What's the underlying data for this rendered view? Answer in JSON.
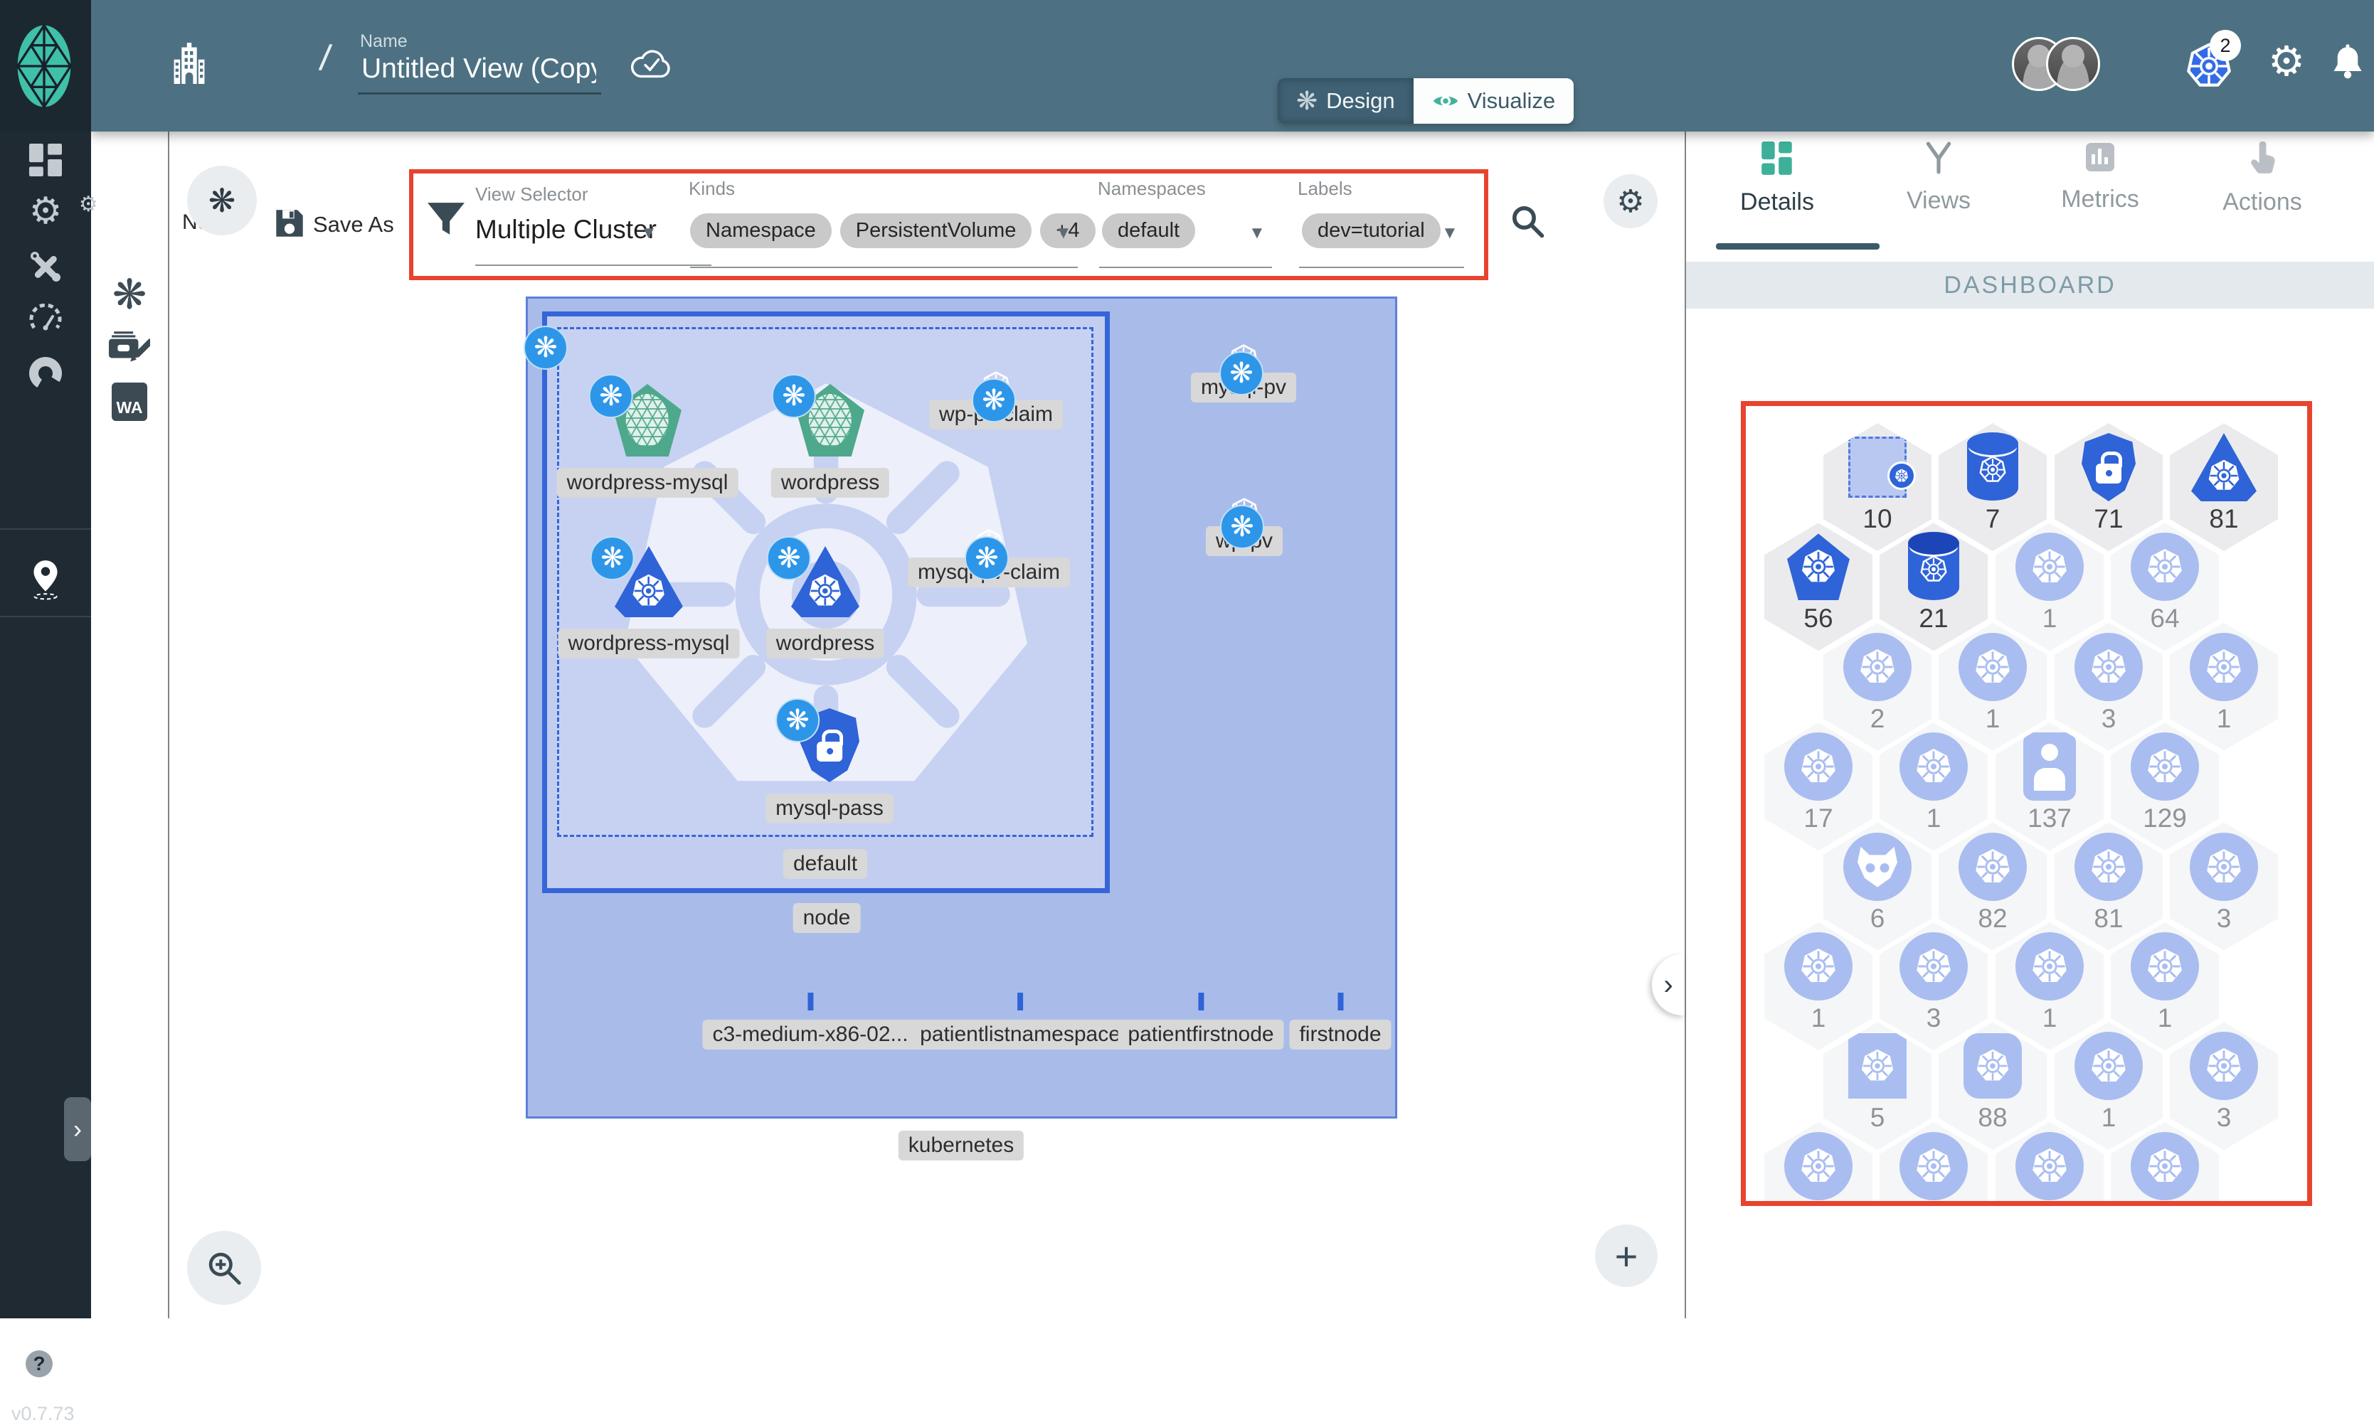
{
  "app": {
    "version": "v0.7.73",
    "help_label": "?"
  },
  "header": {
    "name_label": "Name",
    "name_value": "Untitled View (Copy)",
    "breadcrumb_separator": "/",
    "mode_design": "Design",
    "mode_visualize": "Visualize",
    "k8s_context_count": "2"
  },
  "toolbar": {
    "new_label": "New",
    "save_as_label": "Save As",
    "view_selector_label": "View Selector",
    "view_selector_value": "Multiple Cluster",
    "kinds_label": "Kinds",
    "kinds_chips": [
      "Namespace",
      "PersistentVolume",
      "+4"
    ],
    "namespaces_label": "Namespaces",
    "namespaces_chips": [
      "default"
    ],
    "labels_label": "Labels",
    "labels_chips": [
      "dev=tutorial"
    ]
  },
  "rail": {
    "wasm_label": "WA"
  },
  "panel": {
    "tabs": [
      {
        "label": "Details",
        "active": true
      },
      {
        "label": "Views",
        "active": false
      },
      {
        "label": "Metrics",
        "active": false
      },
      {
        "label": "Actions",
        "active": false
      }
    ],
    "section_title": "DASHBOARD",
    "hex_rows": [
      [
        {
          "icon": "namespace",
          "count": "10",
          "tone": "dark"
        },
        {
          "icon": "pv",
          "count": "7",
          "tone": "dark"
        },
        {
          "icon": "secret",
          "count": "71",
          "tone": "dark"
        },
        {
          "icon": "deployment",
          "count": "81",
          "tone": "dark"
        }
      ],
      [
        {
          "icon": "node",
          "count": "56",
          "tone": "dark"
        },
        {
          "icon": "pvc",
          "count": "21",
          "tone": "dark"
        },
        {
          "icon": "k8s",
          "count": "1",
          "tone": "light"
        },
        {
          "icon": "k8s",
          "count": "64",
          "tone": "light"
        }
      ],
      [
        {
          "icon": "k8s",
          "count": "2",
          "tone": "light"
        },
        {
          "icon": "k8s",
          "count": "1",
          "tone": "light"
        },
        {
          "icon": "k8s",
          "count": "3",
          "tone": "light"
        },
        {
          "icon": "k8s",
          "count": "1",
          "tone": "light"
        }
      ],
      [
        {
          "icon": "k8s",
          "count": "17",
          "tone": "light"
        },
        {
          "icon": "k8s",
          "count": "1",
          "tone": "light"
        },
        {
          "icon": "account",
          "count": "137",
          "tone": "light"
        },
        {
          "icon": "k8s",
          "count": "129",
          "tone": "light"
        }
      ],
      [
        {
          "icon": "mask",
          "count": "6",
          "tone": "light"
        },
        {
          "icon": "k8s",
          "count": "82",
          "tone": "light"
        },
        {
          "icon": "k8s",
          "count": "81",
          "tone": "light"
        },
        {
          "icon": "k8s",
          "count": "3",
          "tone": "light"
        }
      ],
      [
        {
          "icon": "k8s",
          "count": "1",
          "tone": "light"
        },
        {
          "icon": "k8s",
          "count": "3",
          "tone": "light"
        },
        {
          "icon": "k8s",
          "count": "1",
          "tone": "light"
        },
        {
          "icon": "k8s",
          "count": "1",
          "tone": "light"
        }
      ],
      [
        {
          "icon": "square",
          "count": "5",
          "tone": "light"
        },
        {
          "icon": "roundsquare",
          "count": "88",
          "tone": "light"
        },
        {
          "icon": "k8s",
          "count": "1",
          "tone": "light"
        },
        {
          "icon": "k8s",
          "count": "3",
          "tone": "light"
        }
      ],
      [
        {
          "icon": "k8s",
          "count": "",
          "tone": "light"
        },
        {
          "icon": "k8s",
          "count": "",
          "tone": "light"
        },
        {
          "icon": "k8s",
          "count": "",
          "tone": "light"
        },
        {
          "icon": "k8s",
          "count": "",
          "tone": "light"
        }
      ]
    ]
  },
  "canvas": {
    "cluster_label": "kubernetes",
    "node_label": "node",
    "namespace_label": "default",
    "nodes": [
      {
        "id": "svc-wordpress-mysql",
        "kind": "service",
        "label": "wordpress-mysql"
      },
      {
        "id": "svc-wordpress",
        "kind": "service",
        "label": "wordpress"
      },
      {
        "id": "claim-wp-pv-claim",
        "kind": "cylinder",
        "label": "wp-pv-claim"
      },
      {
        "id": "dep-wordpress-mysql",
        "kind": "deployment",
        "label": "wordpress-mysql"
      },
      {
        "id": "dep-wordpress",
        "kind": "deployment",
        "label": "wordpress"
      },
      {
        "id": "claim-mysql-pv-claim",
        "kind": "cylinder",
        "label": "mysql-pv-claim"
      },
      {
        "id": "secret-mysql-pass",
        "kind": "secret",
        "label": "mysql-pass"
      },
      {
        "id": "pv-mysql-pv",
        "kind": "cylinder",
        "label": "mysql-pv"
      },
      {
        "id": "pv-wp-pv",
        "kind": "cylinder",
        "label": "wp-pv"
      },
      {
        "id": "square-c3",
        "kind": "square",
        "label": "c3-medium-x86-02..."
      },
      {
        "id": "square-patientlistnamespace",
        "kind": "square",
        "label": "patientlistnamespace"
      },
      {
        "id": "square-patientfirstnode",
        "kind": "square",
        "label": "patientfirstnode"
      },
      {
        "id": "square-firstnode",
        "kind": "square",
        "label": "firstnode"
      }
    ]
  },
  "colors": {
    "header_teal": "#4d7183",
    "sidebar_dark": "#1f2a33",
    "meshery_green": "#3fc0a9",
    "k8s_blue": "#2f63d8",
    "light_blue": "#a9bdf0",
    "cluster_bg": "#a9bce9",
    "annotation_red": "#e8432e"
  }
}
